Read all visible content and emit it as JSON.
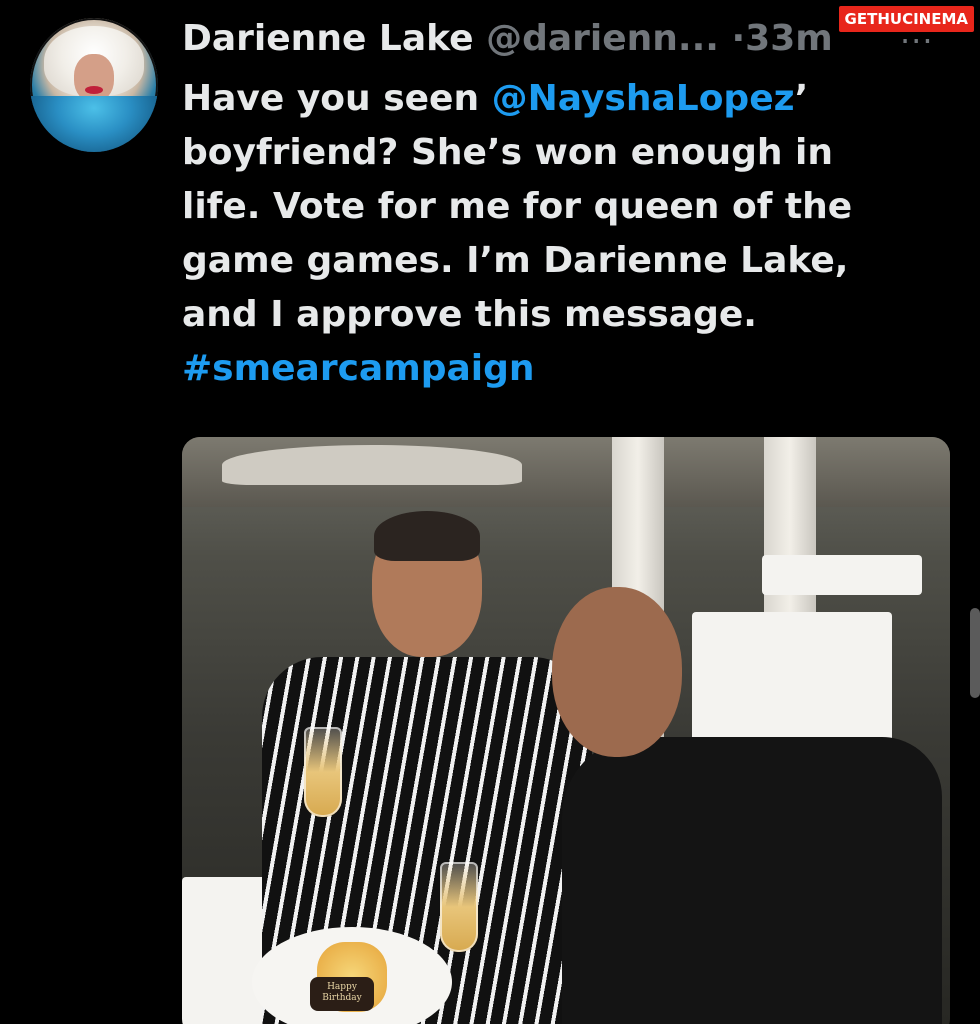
{
  "watermark": "GETHUCINEMA",
  "tweet": {
    "display_name": "Darienne Lake",
    "handle": "@darienn...",
    "separator": "·",
    "time": "33m",
    "more": "···",
    "text_lines": [
      {
        "before": "Have you seen ",
        "mention": "@NayshaLopez",
        "after": "’"
      },
      {
        "text": "boyfriend? She’s won enough in"
      },
      {
        "text": "life. Vote for me for queen of the"
      },
      {
        "text": "game games. I’m Darienne Lake,"
      },
      {
        "text": "and I approve this message."
      },
      {
        "hashtag": "#smearcampaign"
      }
    ],
    "media": {
      "card_line1": "Happy",
      "card_line2": "Birthday"
    }
  }
}
